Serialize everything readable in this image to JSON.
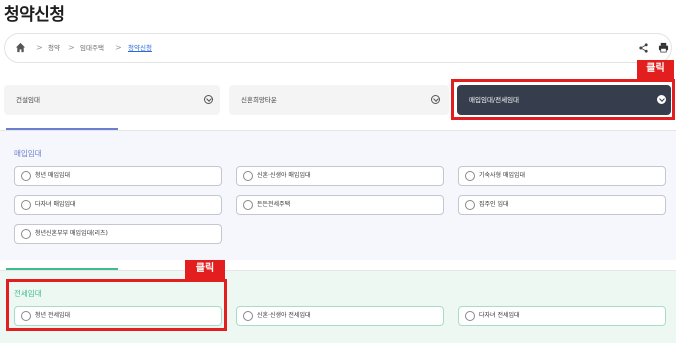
{
  "page": {
    "title": "청약신청"
  },
  "breadcrumb": {
    "items": [
      "청약",
      "임대주택",
      "청약신청"
    ]
  },
  "tabs": [
    {
      "label": "건설임대",
      "active": false
    },
    {
      "label": "신혼희망타운",
      "active": false
    },
    {
      "label": "매입임대/전세임대",
      "active": true
    }
  ],
  "sections": [
    {
      "heading": "매입임대",
      "options": [
        "청년 매입임대",
        "신혼·신생아 매입임대",
        "기숙사형 매입임대",
        "다자녀 매입임대",
        "든든전세주택",
        "집주인 임대",
        "청년신혼부부 매입임대(리츠)"
      ]
    },
    {
      "heading": "전세임대",
      "options": [
        "청년 전세임대",
        "신혼·신생아 전세임대",
        "다자녀 전세임대"
      ]
    }
  ],
  "annotations": {
    "click_label_1": "클릭",
    "click_label_2": "클릭",
    "highlight_color": "#e21e1e"
  },
  "colors": {
    "active_tab_bg": "#363d4d",
    "section_1_accent": "#6b7fd1",
    "section_2_accent": "#3dbb91",
    "breadcrumb_current": "#2b6bd6"
  },
  "icons": [
    "home-icon",
    "share-icon",
    "print-icon",
    "chevron-down-icon"
  ]
}
